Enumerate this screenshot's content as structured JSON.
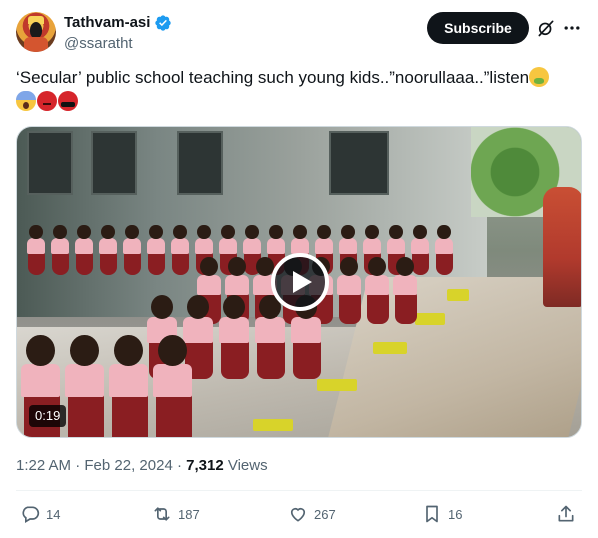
{
  "author": {
    "display_name": "Tathvam-asi",
    "handle": "@ssaratht",
    "verified_icon": "verified-badge-icon",
    "verified_color": "#1d9bf0"
  },
  "header": {
    "subscribe_label": "Subscribe",
    "grok_icon": "grok-icon",
    "more_icon": "more-options-icon"
  },
  "tweet": {
    "text": "‘Secular’ public school teaching such young kids..”noorullaaa..”listen",
    "emojis": [
      "face-vomiting-emoji",
      "face-screaming-emoji",
      "angry-face-emoji",
      "face-with-symbols-emoji"
    ]
  },
  "media": {
    "type": "video",
    "duration": "0:19",
    "play_icon": "play-icon"
  },
  "meta": {
    "time": "1:22 AM",
    "separator": "·",
    "date": "Feb 22, 2024",
    "views_count": "7,312",
    "views_label": "Views"
  },
  "actions": {
    "replies": "14",
    "reposts": "187",
    "likes": "267",
    "bookmarks": "16"
  },
  "colors": {
    "text_primary": "#0f1419",
    "text_secondary": "#536471",
    "button_bg": "#0f1419",
    "border": "#cfd9de"
  }
}
